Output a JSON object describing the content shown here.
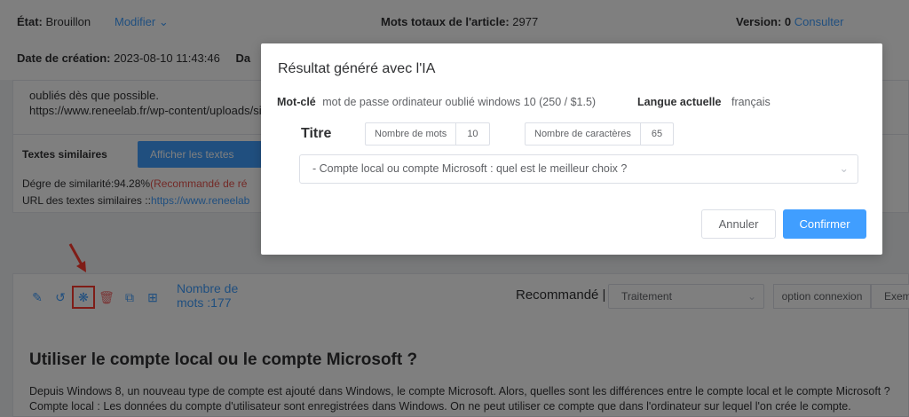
{
  "header": {
    "state_label": "État:",
    "state_value": "Brouillon",
    "modify_label": "Modifier",
    "total_words_label": "Mots totaux de l'article:",
    "total_words_value": "2977",
    "version_label": "Version:",
    "version_value": "0",
    "consult_label": "Consulter",
    "creation_label": "Date de création:",
    "creation_value": "2023-08-10 11:43:46",
    "cut_label": "Da"
  },
  "similar": {
    "text_line1": "oubliés dès que possible.",
    "text_line2": "https://www.reneelab.fr/wp-content/uploads/sit",
    "heading": "Textes similaires",
    "show_button": "Afficher les textes similaire",
    "degree_label": "Dégre de similarité:94.28%",
    "degree_note": "(Recommandé de ré",
    "url_label": "URL des textes similaires ::",
    "url_value": "https://www.reneelab"
  },
  "editor": {
    "word_count": "Nombre de mots :177",
    "recommended_label": "Recommandé |",
    "treatment_value": "Traitement",
    "option_button": "option connexion",
    "example_button": "Exem",
    "heading": "Utiliser le compte local ou le compte Microsoft ?",
    "paragraph1": "Depuis Windows 8, un nouveau type de compte est ajouté dans Windows, le compte Microsoft. Alors, quelles sont les différences entre le compte local et le compte Microsoft ?",
    "paragraph2": "Compte local : Les données du compte d'utilisateur sont enregistrées dans Windows. On ne peut utiliser ce compte que dans l'ordinateur sur lequel l'on crée le compte."
  },
  "modal": {
    "title": "Résultat généré avec l'IA",
    "keyword_label": "Mot-clé",
    "keyword_value": "mot de passe ordinateur oublié windows 10 (250 / $1.5)",
    "language_label": "Langue actuelle",
    "language_value": "français",
    "titre_label": "Titre",
    "words_label": "Nombre de mots",
    "words_value": "10",
    "chars_label": "Nombre de caractères",
    "chars_value": "65",
    "selected_title": "- Compte local ou compte Microsoft : quel est le meilleur choix ?",
    "cancel_button": "Annuler",
    "confirm_button": "Confirmer"
  },
  "colors": {
    "accent": "#409eff",
    "danger": "#f56c6c",
    "highlight": "#ff3b2f"
  }
}
